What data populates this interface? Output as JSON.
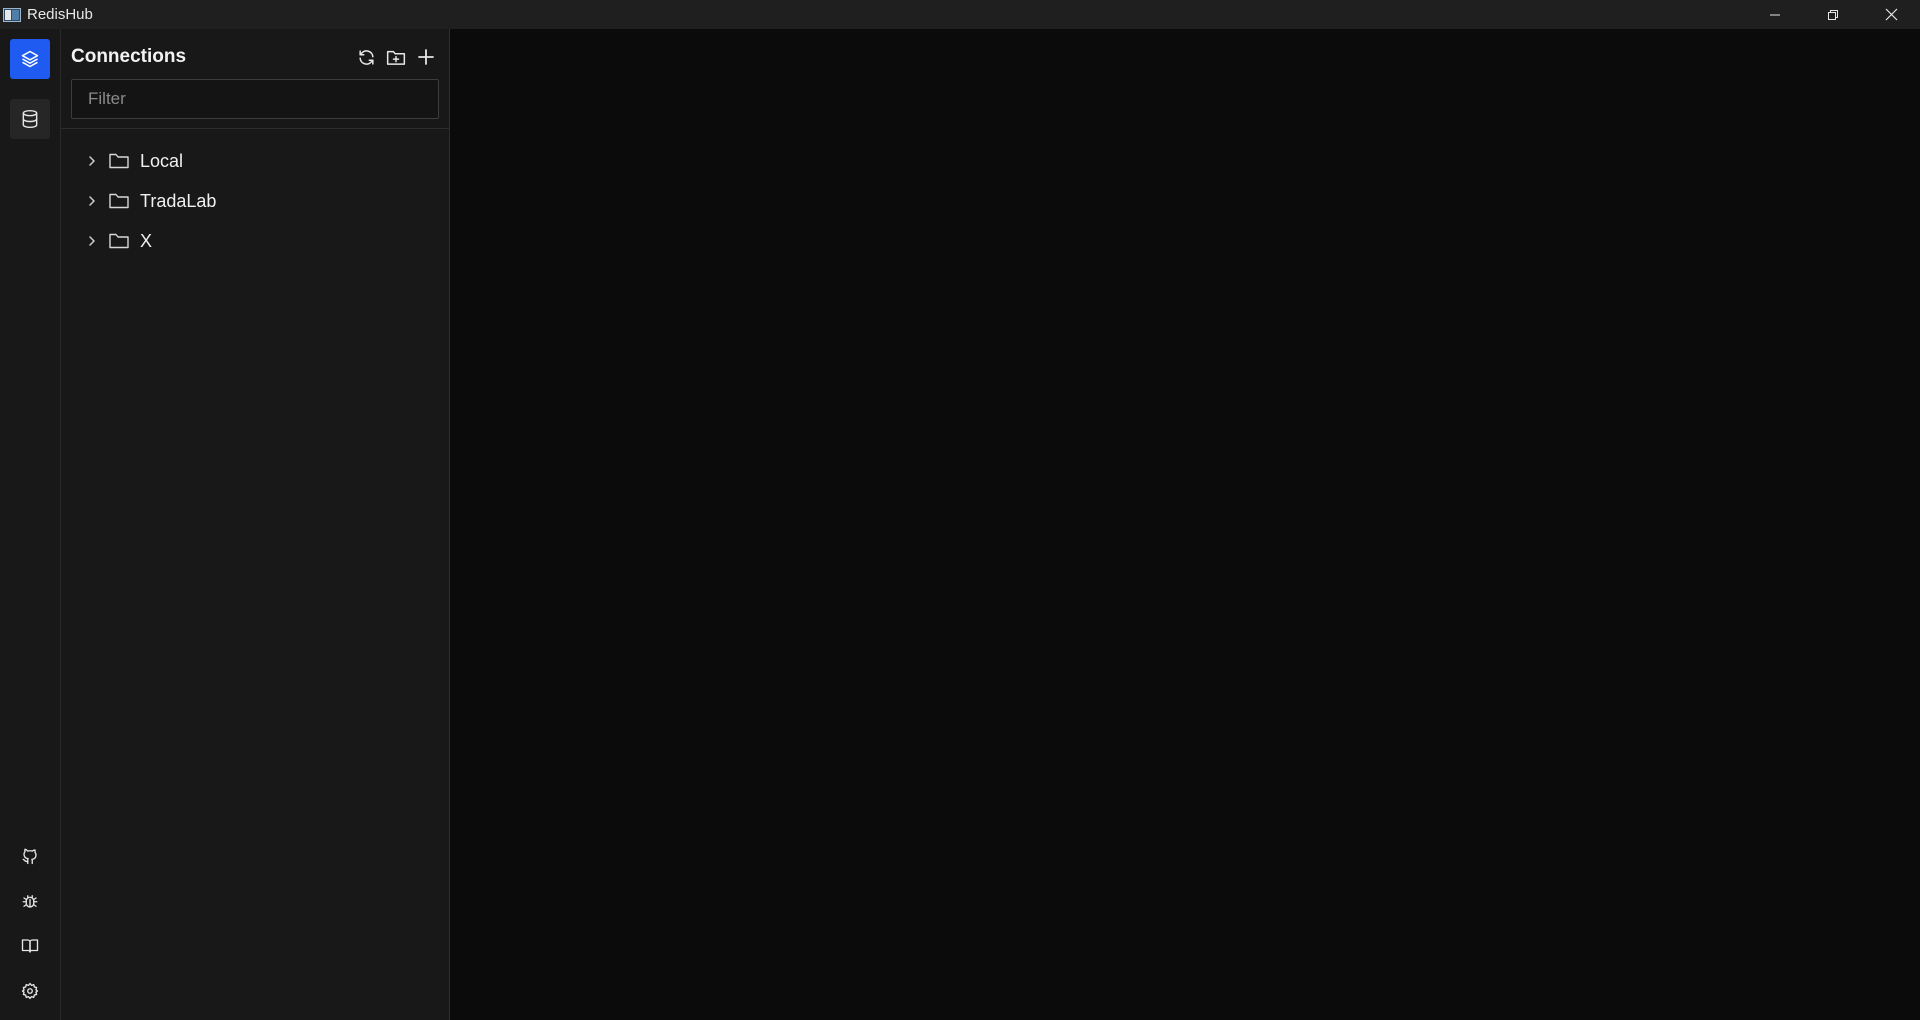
{
  "window": {
    "title": "RedisHub",
    "controls": [
      "minimize-icon",
      "restore-icon",
      "close-icon"
    ]
  },
  "activitybar": {
    "top": [
      {
        "name": "connections",
        "icon": "layers-icon",
        "state": "active"
      },
      {
        "name": "database",
        "icon": "database-icon",
        "state": "selected"
      }
    ],
    "bottom": [
      {
        "name": "github",
        "icon": "github-icon"
      },
      {
        "name": "debug",
        "icon": "bug-icon"
      },
      {
        "name": "docs",
        "icon": "book-icon"
      },
      {
        "name": "settings",
        "icon": "gear-icon"
      }
    ]
  },
  "sidebar": {
    "title": "Connections",
    "actions": [
      "refresh-icon",
      "new-folder-icon",
      "add-icon"
    ],
    "filter": {
      "placeholder": "Filter",
      "value": ""
    },
    "tree": [
      {
        "label": "Local",
        "expanded": false
      },
      {
        "label": "TradaLab",
        "expanded": false
      },
      {
        "label": "X",
        "expanded": false
      }
    ]
  },
  "colors": {
    "accent": "#1f5bf0",
    "titlebar": "#1f1f1f",
    "sidebar": "#181818",
    "main": "#0b0b0b"
  }
}
